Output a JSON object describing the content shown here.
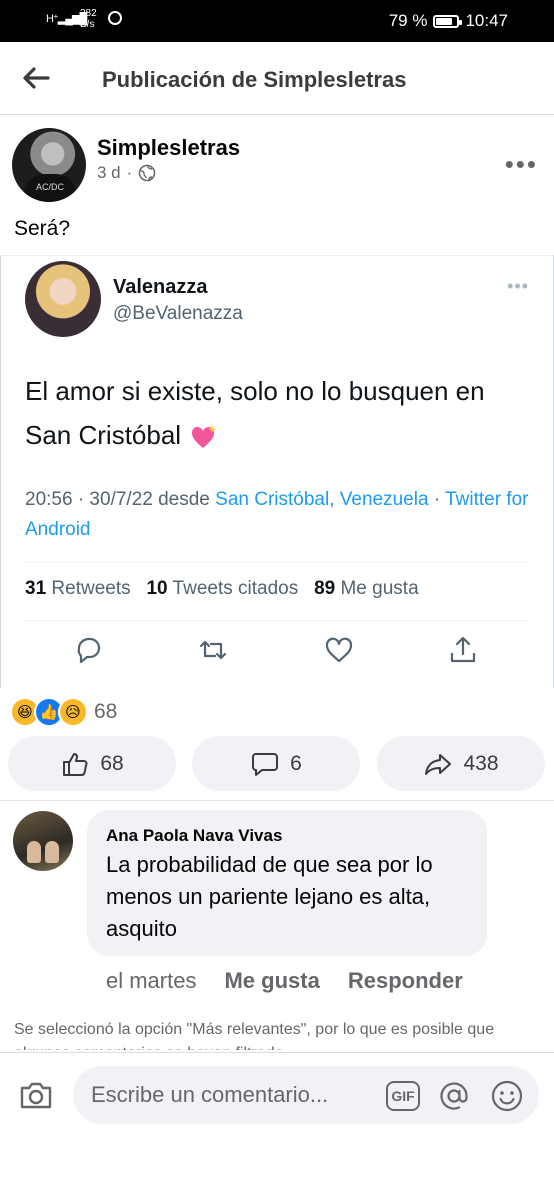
{
  "status_bar": {
    "network": "H⁺",
    "speed_value": "282",
    "speed_unit": "B/s",
    "battery_percent": "79 %",
    "battery_level": 0.79,
    "time": "10:47"
  },
  "app_bar": {
    "title": "Publicación de Simplesletras"
  },
  "post": {
    "author": "Simplesletras",
    "age": "3 d",
    "caption": "Será?",
    "avatar_shirt_text": "AC/DC"
  },
  "tweet": {
    "name": "Valenazza",
    "handle": "@BeValenazza",
    "text": "El amor si existe, solo no lo busquen en San Cristóbal",
    "time_prefix": "20:56 · 30/7/22 desde",
    "location": "San Cristóbal, Venezuela",
    "sep": "·",
    "client": "Twitter for Android",
    "retweets_count": "31",
    "retweets_label": "Retweets",
    "quotes_count": "10",
    "quotes_label": "Tweets citados",
    "likes_count": "89",
    "likes_label": "Me gusta"
  },
  "reactions": {
    "count": "68",
    "emojis": [
      "haha",
      "like",
      "sad"
    ]
  },
  "actions": {
    "like_count": "68",
    "comment_count": "6",
    "share_count": "438"
  },
  "comment": {
    "author": "Ana Paola Nava Vivas",
    "text": "La probabilidad de que sea por lo menos un pariente lejano es alta, asquito",
    "time": "el martes",
    "like_label": "Me gusta",
    "reply_label": "Responder"
  },
  "notice": "Se seleccionó la opción \"Más relevantes\", por lo que es posible que algunos comentarios se hayan filtrado.",
  "composer": {
    "placeholder": "Escribe un comentario...",
    "gif_label": "GIF"
  },
  "colors": {
    "accent_fb": "#1877f2",
    "twitter_link": "#1d9bf0",
    "secondary_text": "#65676b",
    "pill_bg": "#f0f2f5"
  }
}
